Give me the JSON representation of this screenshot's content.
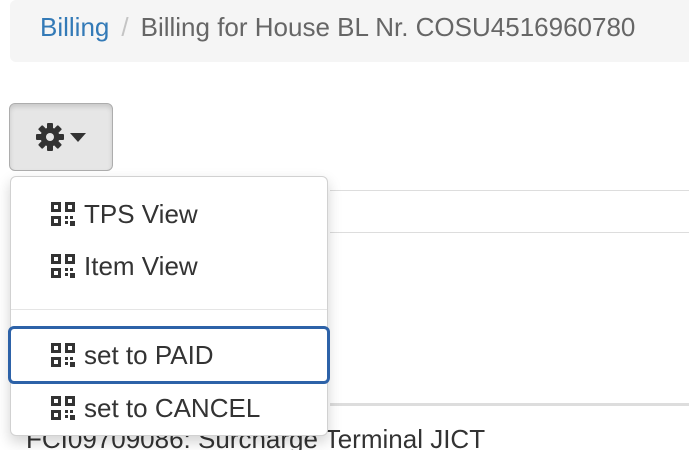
{
  "breadcrumb": {
    "parent": "Billing",
    "separator": "/",
    "current": "Billing for House BL Nr. COSU4516960780"
  },
  "toolbar": {
    "gear_icon": "gear-icon",
    "caret_icon": "caret-down-icon"
  },
  "menu": {
    "items": [
      {
        "label": "TPS View",
        "icon": "qrcode-icon"
      },
      {
        "label": "Item View",
        "icon": "qrcode-icon"
      },
      {
        "label": "set to PAID",
        "icon": "qrcode-icon"
      },
      {
        "label": "set to CANCEL",
        "icon": "qrcode-icon"
      }
    ],
    "focused_item": "set to PAID"
  },
  "background": {
    "row_text": "FCI09709086: Surcharge Terminal JICT"
  },
  "colors": {
    "link": "#337ab7",
    "focus_ring": "#2d62a8",
    "breadcrumb_bg": "#f5f5f5"
  }
}
